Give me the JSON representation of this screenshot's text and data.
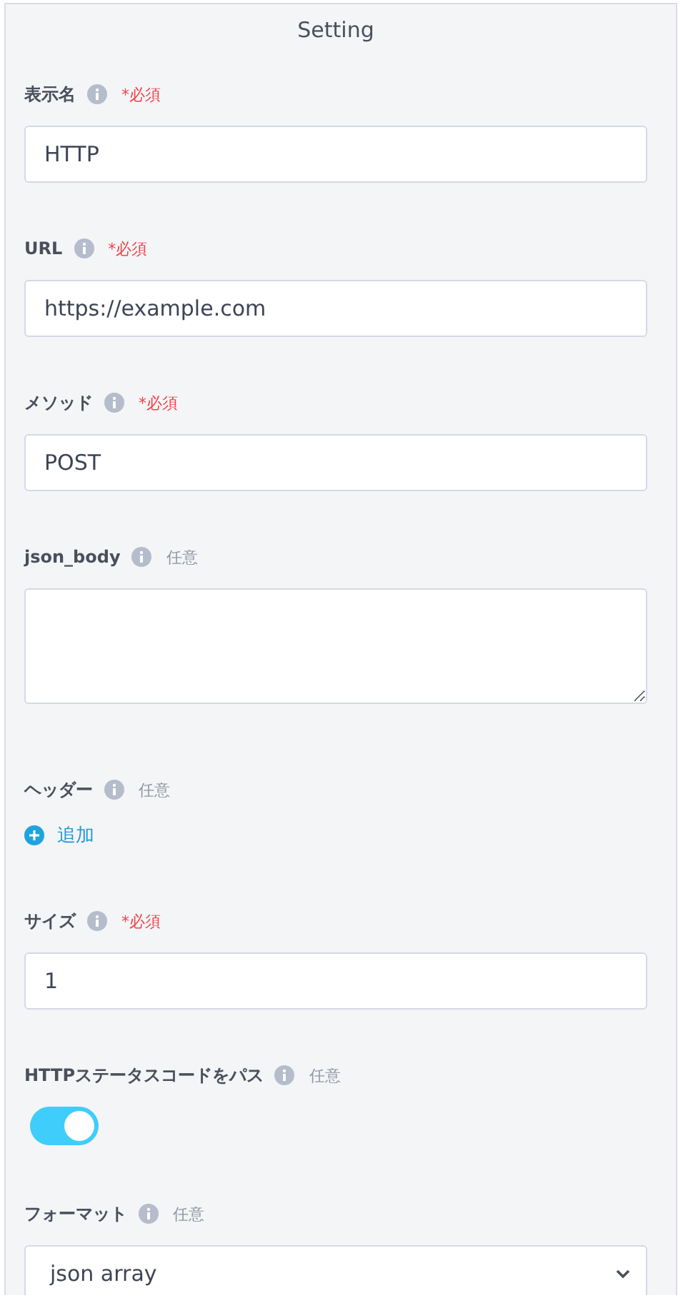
{
  "title": "Setting",
  "fields": [
    {
      "kind": "text",
      "label": "表示名",
      "required": true,
      "tag": "*必須",
      "value": "HTTP"
    },
    {
      "kind": "text",
      "label": "URL",
      "required": true,
      "tag": "*必須",
      "value": "https://example.com"
    },
    {
      "kind": "text",
      "label": "メソッド",
      "required": true,
      "tag": "*必須",
      "value": "POST"
    },
    {
      "kind": "textarea",
      "label": "json_body",
      "required": false,
      "tag": "任意"
    },
    {
      "kind": "add",
      "label": "ヘッダー",
      "required": false,
      "tag": "任意",
      "action": "追加"
    },
    {
      "kind": "text",
      "label": "サイズ",
      "required": true,
      "tag": "*必須",
      "value": "1"
    },
    {
      "kind": "toggle",
      "label": "HTTPステータスコードをパス",
      "required": false,
      "tag": "任意",
      "on": true
    },
    {
      "kind": "select",
      "label": "フォーマット",
      "required": false,
      "tag": "任意",
      "value": "json array"
    }
  ]
}
